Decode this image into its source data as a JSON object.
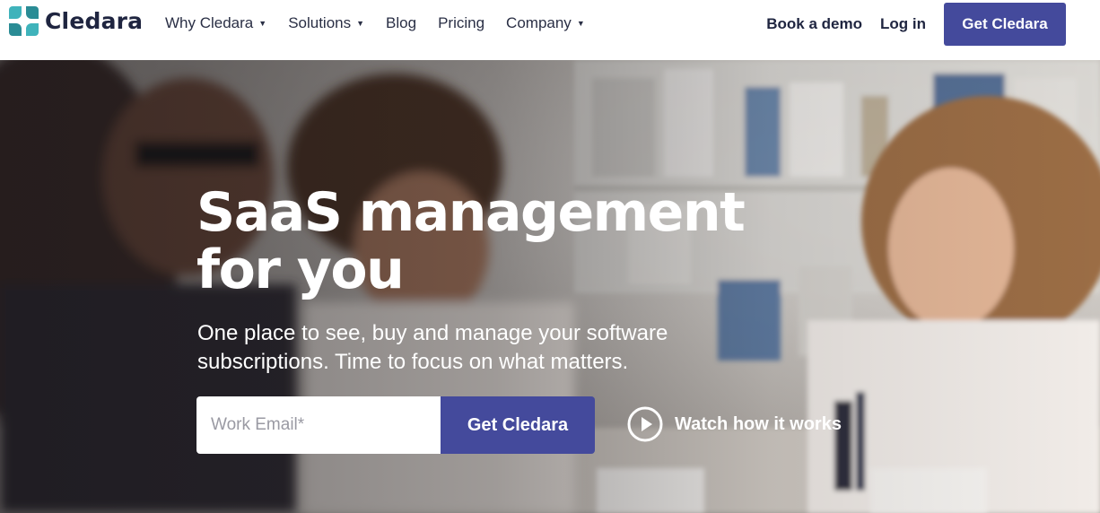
{
  "brand": {
    "name": "Cledara",
    "colors": {
      "primary": "#444a9c",
      "logo_teal": "#3fb3bb",
      "logo_dark": "#2a8c95",
      "text_dark": "#1f2540"
    }
  },
  "nav": {
    "items": [
      {
        "label": "Why Cledara",
        "has_dropdown": true
      },
      {
        "label": "Solutions",
        "has_dropdown": true
      },
      {
        "label": "Blog",
        "has_dropdown": false
      },
      {
        "label": "Pricing",
        "has_dropdown": false
      },
      {
        "label": "Company",
        "has_dropdown": true
      }
    ],
    "book_demo": "Book a demo",
    "login": "Log in",
    "cta": "Get Cledara",
    "dropdown_icon": "caret-down-icon"
  },
  "hero": {
    "headline_line1": "SaaS management",
    "headline_line2": "for you",
    "subline_line1": "One place to see, buy and manage your software",
    "subline_line2": "subscriptions. Time to focus on what matters.",
    "email_placeholder": "Work Email*",
    "email_value": "",
    "form_cta": "Get Cledara",
    "watch_label": "Watch how it works",
    "watch_icon": "play-circle-icon"
  }
}
